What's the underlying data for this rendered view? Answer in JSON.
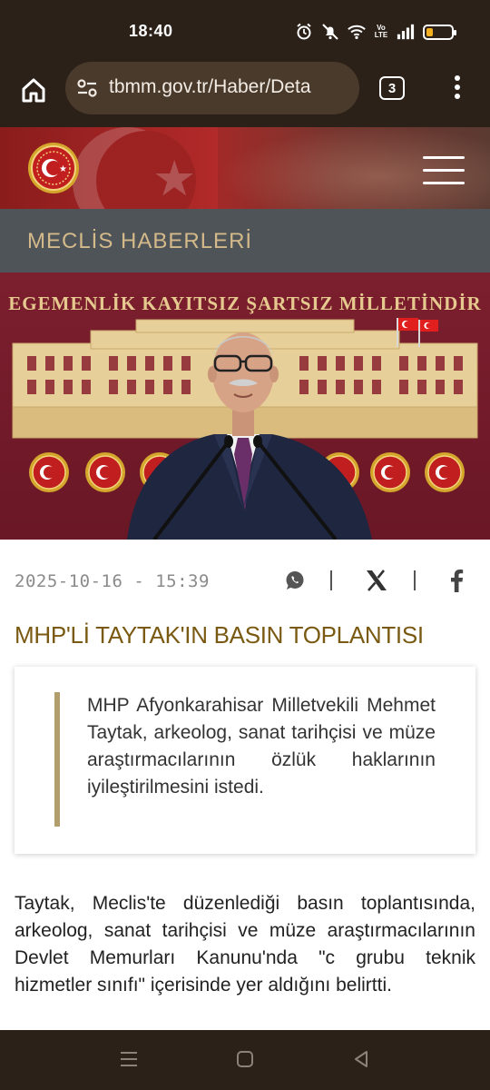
{
  "status_bar": {
    "time": "18:40",
    "icons": [
      "alarm-icon",
      "mute-icon",
      "wifi-icon",
      "volte-icon",
      "signal-icon",
      "battery-icon"
    ],
    "volte_label": "Vo LTE",
    "battery_level": 0.25,
    "battery_color": "#f2b020"
  },
  "browser": {
    "url": "tbmm.gov.tr/Haber/Deta",
    "tab_count": "3"
  },
  "site": {
    "section_title": "MECLİS HABERLERİ",
    "hero_motto": "EGEMENLİK KAYITSIZ ŞARTSIZ MİLLETİNDİR"
  },
  "article": {
    "date": "2025-10-16 - 15:39",
    "share_icons": [
      "whatsapp-icon",
      "x-icon",
      "facebook-icon"
    ],
    "title": "MHP'Lİ TAYTAK'IN BASIN TOPLANTISI",
    "summary": "MHP Afyonkarahisar Milletvekili Mehmet Taytak, arkeolog, sanat tarihçisi ve müze araştırmacılarının özlük haklarının iyileştirilmesini istedi.",
    "body": "Taytak, Meclis'te düzenlediği basın toplantısında, arkeolog, sanat tarihçisi ve müze araştırmacılarının Devlet Memurları Kanunu'nda \"c grubu teknik hizmetler sınıfı\" içerisinde yer aldığını belirtti."
  },
  "colors": {
    "chrome_bg": "#2b2118",
    "header_red": "#b32a2a",
    "section_bg": "#4e5457",
    "section_text": "#d4b98a",
    "title_color": "#7a5a12",
    "accent_bar": "#b29e6d"
  }
}
